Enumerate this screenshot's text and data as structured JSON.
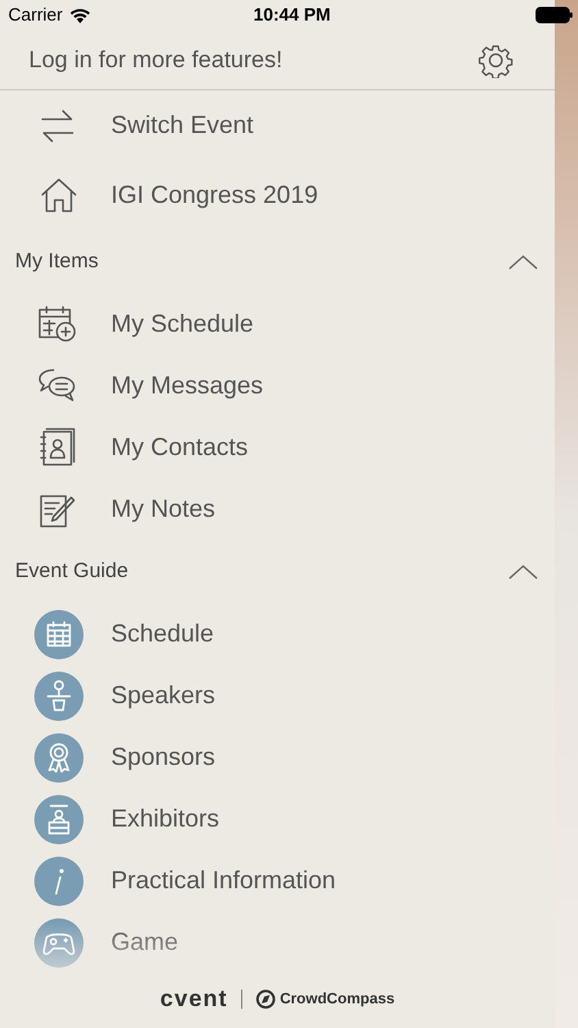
{
  "status_bar": {
    "carrier": "Carrier",
    "time": "10:44 PM"
  },
  "header": {
    "title": "Log in for more features!"
  },
  "top_items": [
    {
      "label": "Switch Event"
    },
    {
      "label": "IGI Congress 2019"
    }
  ],
  "sections": [
    {
      "title": "My Items",
      "expanded": true,
      "kind": "outline",
      "items": [
        {
          "label": "My Schedule"
        },
        {
          "label": "My Messages"
        },
        {
          "label": "My Contacts"
        },
        {
          "label": "My Notes"
        }
      ]
    },
    {
      "title": "Event Guide",
      "expanded": true,
      "kind": "circle",
      "items": [
        {
          "label": "Schedule"
        },
        {
          "label": "Speakers"
        },
        {
          "label": "Sponsors"
        },
        {
          "label": "Exhibitors"
        },
        {
          "label": "Practical Information"
        },
        {
          "label": "Game"
        }
      ]
    }
  ],
  "footer": {
    "brand_1": "cvent",
    "brand_2": "CrowdCompass"
  }
}
